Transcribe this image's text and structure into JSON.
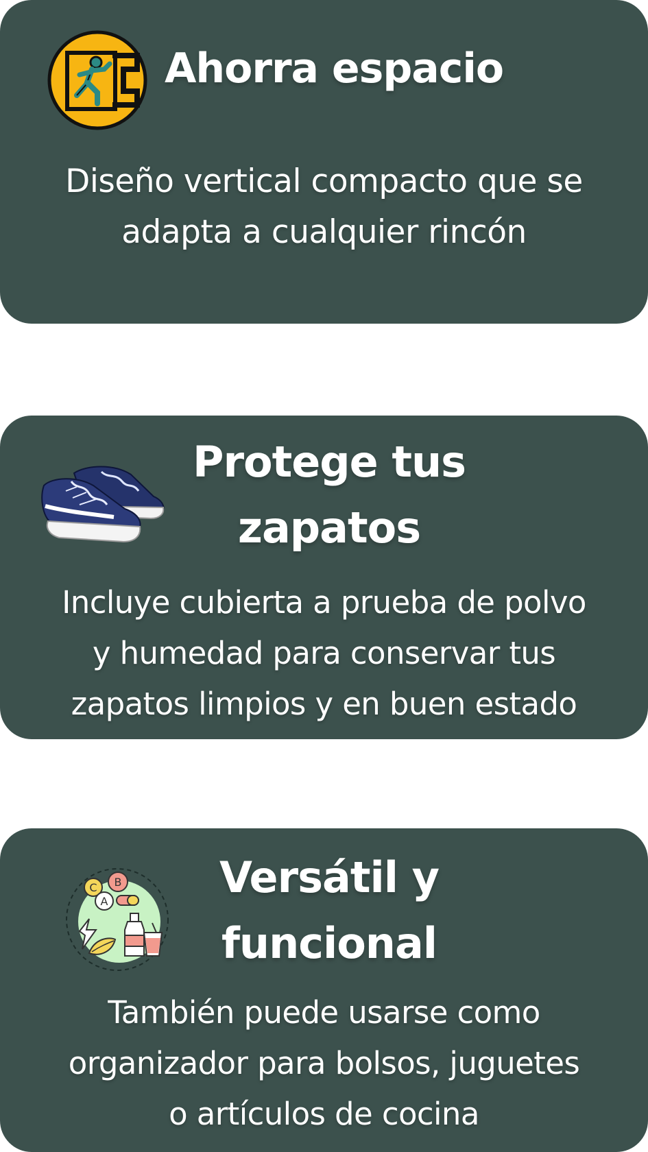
{
  "cards": [
    {
      "title": "Ahorra espacio",
      "description_lines": [
        "Diseño vertical compacto que se",
        "adapta a cualquier rincón"
      ],
      "icon": "emergency-exit-icon"
    },
    {
      "title_lines": [
        "Protege tus",
        "zapatos"
      ],
      "description_lines": [
        "Incluye cubierta a prueba de polvo",
        "y humedad para conservar tus",
        "zapatos limpios y en buen estado"
      ],
      "icon": "sneakers-icon"
    },
    {
      "title_lines": [
        "Versátil y",
        "funcional"
      ],
      "description_lines": [
        "También puede usarse como",
        "organizador para bolsos, juguetes",
        "o artículos de cocina"
      ],
      "icon": "nutrition-vitamins-icon",
      "icon_letters": [
        "C",
        "B",
        "A"
      ]
    }
  ],
  "colors": {
    "card_background": "#3c514d",
    "text": "#ffffff",
    "exit_icon_yellow": "#f7b512",
    "exit_icon_figure": "#2c8a85",
    "sneaker_navy": "#25336b",
    "icon_circle_green": "#c8f2c4"
  }
}
